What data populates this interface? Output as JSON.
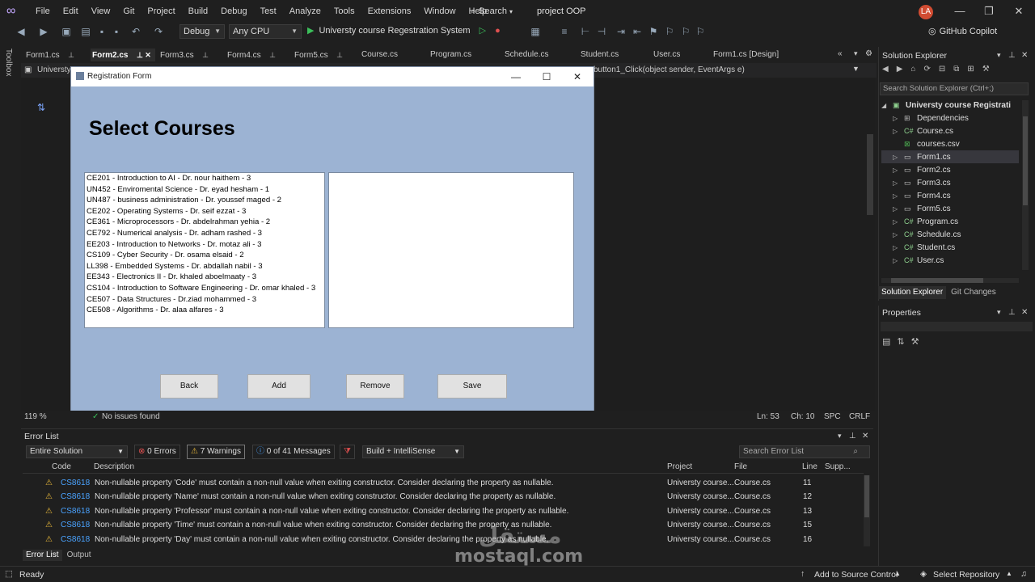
{
  "menu": [
    "File",
    "Edit",
    "View",
    "Git",
    "Project",
    "Build",
    "Debug",
    "Test",
    "Analyze",
    "Tools",
    "Extensions",
    "Window",
    "Help"
  ],
  "search_label": "Search",
  "project_name": "project OOP",
  "avatar": "LA",
  "toolbar": {
    "config": "Debug",
    "platform": "Any CPU",
    "run_target": "Universty course Regestration System",
    "copilot": "GitHub Copilot"
  },
  "toolbox_label": "Toolbox",
  "tabs": [
    "Form1.cs",
    "Form2.cs",
    "Form3.cs",
    "Form4.cs",
    "Form5.cs",
    "Course.cs",
    "Program.cs",
    "Schedule.cs",
    "Student.cs",
    "User.cs",
    "Form1.cs [Design]"
  ],
  "nav": {
    "left": "Universty",
    "right": "button1_Click(object sender, EventArgs e)"
  },
  "form": {
    "title": "Registration Form",
    "heading": "Select Courses",
    "courses": [
      "CE201 - Introduction to AI - Dr. nour haithem - 3",
      "UN452 - Enviromental Science - Dr. eyad hesham - 1",
      "UN487 - business administration - Dr. youssef maged - 2",
      "CE202 - Operating Systems - Dr. seif ezzat - 3",
      "CE361 - Microprocessors - Dr. abdelrahman yehia - 2",
      "CE792 - Numerical analysis - Dr. adham rashed - 3",
      "EE203 - Introduction to Networks - Dr. motaz ali - 3",
      "CS109 - Cyber Security - Dr. osama elsaid - 2",
      "LL398 - Embedded Systems - Dr. abdallah nabil - 3",
      "EE343 - Electronics II - Dr. khaled aboelmaaty - 3",
      "CS104 - Introduction to Software Engineering - Dr. omar khaled - 3",
      "CE507 - Data Structures - Dr.ziad mohammed - 3",
      "CE508 - Algorithms - Dr. alaa alfares - 3"
    ],
    "buttons": {
      "back": "Back",
      "add": "Add",
      "remove": "Remove",
      "save": "Save"
    }
  },
  "editor_status": {
    "zoom": "119 %",
    "issues": "No issues found",
    "ln": "Ln: 53",
    "ch": "Ch: 10",
    "spc": "SPC",
    "crlf": "CRLF"
  },
  "solution_explorer": {
    "title": "Solution Explorer",
    "search_placeholder": "Search Solution Explorer (Ctrl+;)",
    "root": "Universty course Registrati",
    "items": [
      "Dependencies",
      "Course.cs",
      "courses.csv",
      "Form1.cs",
      "Form2.cs",
      "Form3.cs",
      "Form4.cs",
      "Form5.cs",
      "Program.cs",
      "Schedule.cs",
      "Student.cs",
      "User.cs"
    ],
    "tab_se": "Solution Explorer",
    "tab_git": "Git Changes"
  },
  "properties": {
    "title": "Properties"
  },
  "error_list": {
    "title": "Error List",
    "scope": "Entire Solution",
    "errors": "0 Errors",
    "warnings": "7 Warnings",
    "messages": "0 of 41 Messages",
    "build_filter": "Build + IntelliSense",
    "search_placeholder": "Search Error List",
    "headers": {
      "code": "Code",
      "description": "Description",
      "project": "Project",
      "file": "File",
      "line": "Line",
      "suppression": "Supp..."
    },
    "rows": [
      {
        "code": "CS8618",
        "description": "Non-nullable property 'Code' must contain a non-null value when exiting constructor. Consider declaring the property as nullable.",
        "project": "Universty course...",
        "file": "Course.cs",
        "line": "11"
      },
      {
        "code": "CS8618",
        "description": "Non-nullable property 'Name' must contain a non-null value when exiting constructor. Consider declaring the property as nullable.",
        "project": "Universty course...",
        "file": "Course.cs",
        "line": "12"
      },
      {
        "code": "CS8618",
        "description": "Non-nullable property 'Professor' must contain a non-null value when exiting constructor. Consider declaring the property as nullable.",
        "project": "Universty course...",
        "file": "Course.cs",
        "line": "13"
      },
      {
        "code": "CS8618",
        "description": "Non-nullable property 'Time' must contain a non-null value when exiting constructor. Consider declaring the property as nullable.",
        "project": "Universty course...",
        "file": "Course.cs",
        "line": "15"
      },
      {
        "code": "CS8618",
        "description": "Non-nullable property 'Day' must contain a non-null value when exiting constructor. Consider declaring the property as nullable.",
        "project": "Universty course...",
        "file": "Course.cs",
        "line": "16"
      }
    ],
    "tab_errors": "Error List",
    "tab_output": "Output"
  },
  "statusbar": {
    "ready": "Ready",
    "source_control": "Add to Source Control",
    "repository": "Select Repository"
  },
  "watermark": {
    "latin": "mostaql.com",
    "arabic": "مستقل"
  },
  "colors": {
    "form_bg": "#9cb3d3",
    "accent": "#c4a8ff",
    "warning": "#e8b83a",
    "run": "#3bbf5a",
    "avatar": "#d14c32"
  }
}
